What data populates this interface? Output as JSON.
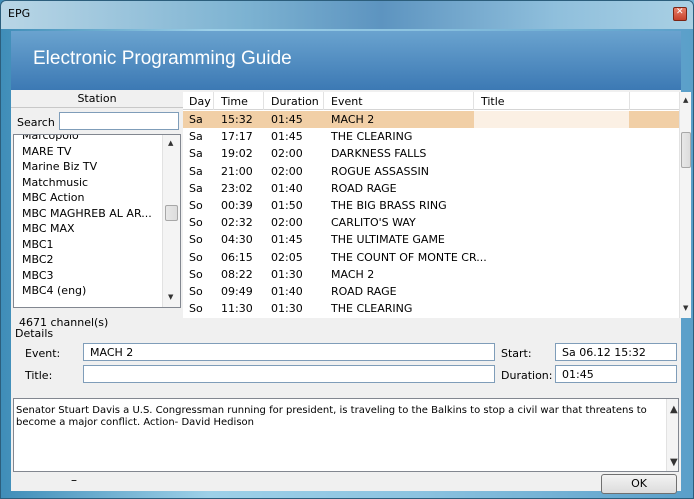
{
  "window": {
    "title": "EPG",
    "close_glyph": "✕"
  },
  "banner": {
    "title": "Electronic Programming Guide"
  },
  "station": {
    "header": "Station",
    "search_label": "Search",
    "search_value": "",
    "items": [
      "Marcopolo",
      "MARE TV",
      "Marine Biz TV",
      "Matchmusic",
      "MBC Action",
      "MBC MAGHREB AL AR...",
      "MBC MAX",
      "MBC1",
      "MBC2",
      "MBC3",
      "MBC4 (eng)"
    ],
    "count": "4671 channel(s)"
  },
  "table": {
    "headers": {
      "day": "Day",
      "time": "Time",
      "duration": "Duration",
      "event": "Event",
      "title": "Title"
    },
    "rows": [
      {
        "day": "Sa",
        "time": "15:32",
        "duration": "01:45",
        "event": "MACH 2",
        "selected": true
      },
      {
        "day": "Sa",
        "time": "17:17",
        "duration": "01:45",
        "event": "THE CLEARING"
      },
      {
        "day": "Sa",
        "time": "19:02",
        "duration": "02:00",
        "event": "DARKNESS FALLS"
      },
      {
        "day": "Sa",
        "time": "21:00",
        "duration": "02:00",
        "event": "ROGUE ASSASSIN"
      },
      {
        "day": "Sa",
        "time": "23:02",
        "duration": "01:40",
        "event": "ROAD RAGE"
      },
      {
        "day": "So",
        "time": "00:39",
        "duration": "01:50",
        "event": "THE BIG BRASS RING"
      },
      {
        "day": "So",
        "time": "02:32",
        "duration": "02:00",
        "event": "CARLITO'S WAY"
      },
      {
        "day": "So",
        "time": "04:30",
        "duration": "01:45",
        "event": "THE ULTIMATE GAME"
      },
      {
        "day": "So",
        "time": "06:15",
        "duration": "02:05",
        "event": "THE COUNT OF MONTE CR..."
      },
      {
        "day": "So",
        "time": "08:22",
        "duration": "01:30",
        "event": "MACH 2"
      },
      {
        "day": "So",
        "time": "09:49",
        "duration": "01:40",
        "event": "ROAD RAGE"
      },
      {
        "day": "So",
        "time": "11:30",
        "duration": "01:30",
        "event": "THE CLEARING"
      }
    ]
  },
  "details": {
    "section_label": "Details",
    "event_label": "Event:",
    "event_value": "MACH 2",
    "title_label": "Title:",
    "title_value": "",
    "start_label": "Start:",
    "start_value": "Sa 06.12   15:32",
    "duration_label": "Duration:",
    "duration_value": "01:45",
    "description": "Senator Stuart Davis a U.S. Congressman running for president, is traveling to the Balkins to stop a civil war that threatens to become a major conflict. Action- David Hedison"
  },
  "footer": {
    "ok_label": "OK",
    "dash": "–"
  },
  "colors": {
    "selected_row": "#f1cfa6",
    "banner": "#3c79b4"
  }
}
